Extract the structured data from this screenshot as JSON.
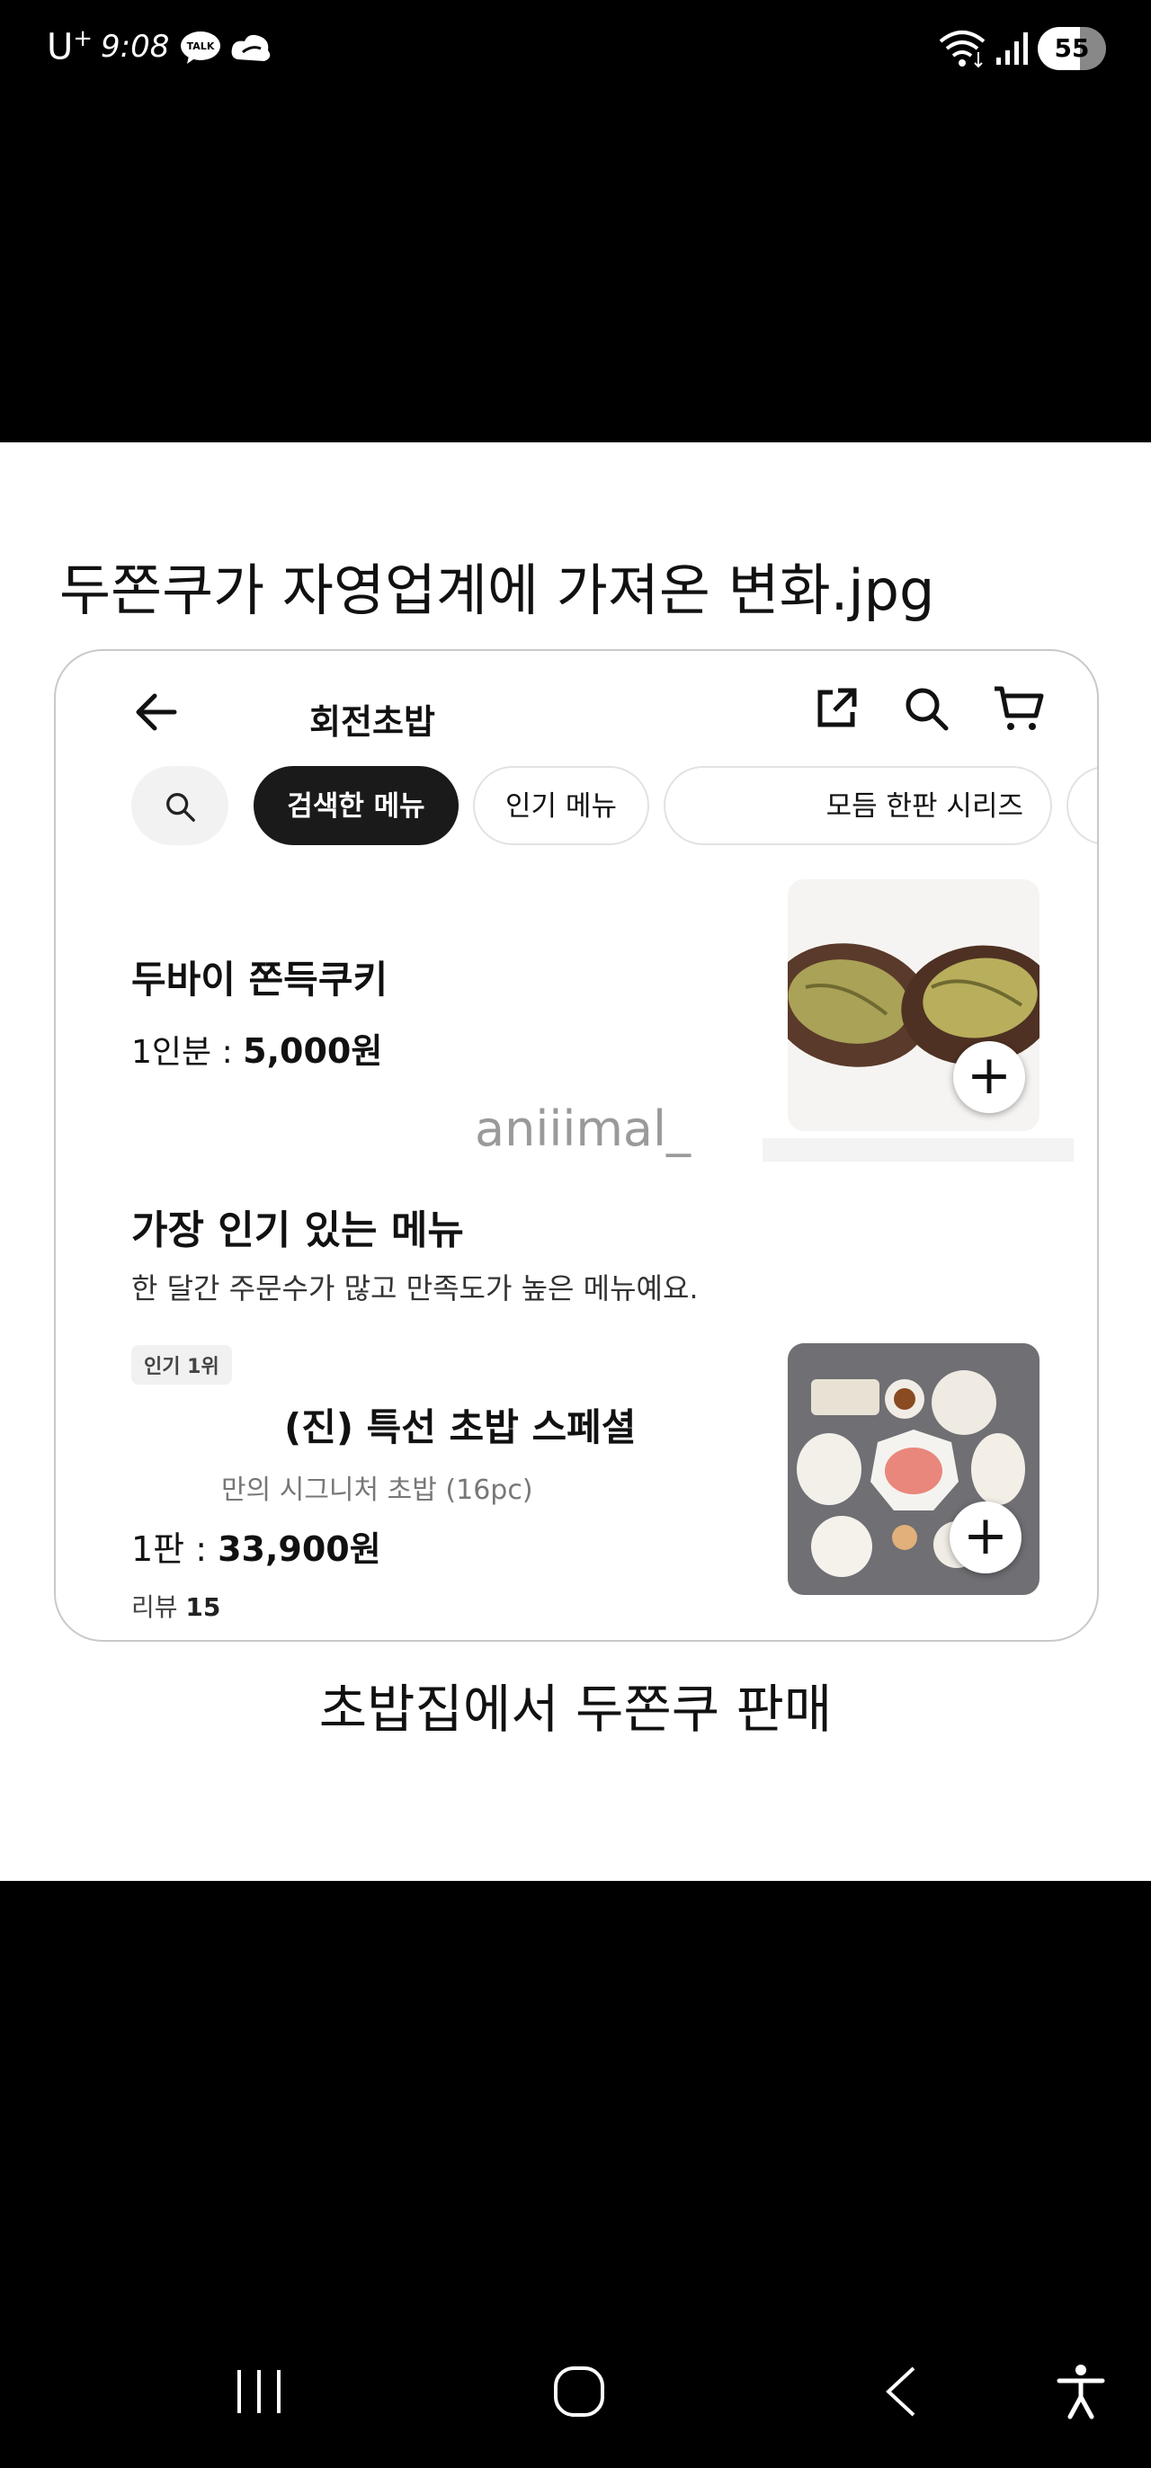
{
  "status_bar": {
    "carrier": "U",
    "carrier_sup": "+",
    "time": "9:08",
    "talk_icon_label": "TALK",
    "battery": "55"
  },
  "post": {
    "title": "두쫀쿠가 자영업계에 가져온 변화.jpg",
    "caption": "초밥집에서 두쫀쿠 판매"
  },
  "screenshot": {
    "header": {
      "title": "회전초밥",
      "icons": [
        "back-arrow-icon",
        "share-icon",
        "search-icon",
        "cart-icon"
      ]
    },
    "chips": [
      {
        "label": "검색한 메뉴",
        "active": true
      },
      {
        "label": "인기 메뉴",
        "active": false
      },
      {
        "label": "모듬 한판 시리즈",
        "active": false
      }
    ],
    "item1": {
      "name": "두바이 쫀득쿠키",
      "price_prefix": "1인분 : ",
      "price": "5,000원"
    },
    "watermark": "aniiimal_",
    "popular": {
      "title": "가장 인기 있는 메뉴",
      "subtitle": "한 달간 주문수가 많고 만족도가 높은 메뉴예요.",
      "badge": "인기 1위",
      "name": "(진) 특선 초밥 스페셜",
      "description": "만의 시그니처 초밥 (16pc)",
      "price_prefix": "1판 : ",
      "price": "33,900원",
      "reviews_label": "리뷰 ",
      "reviews_count": "15"
    },
    "colors": {
      "active_chip": "#1a1a1a",
      "chip_border": "#e2e2e2",
      "card_border": "#c9c9c9"
    }
  },
  "nav_bar": {
    "icons": [
      "recents-icon",
      "home-icon",
      "back-icon",
      "accessibility-icon"
    ]
  }
}
